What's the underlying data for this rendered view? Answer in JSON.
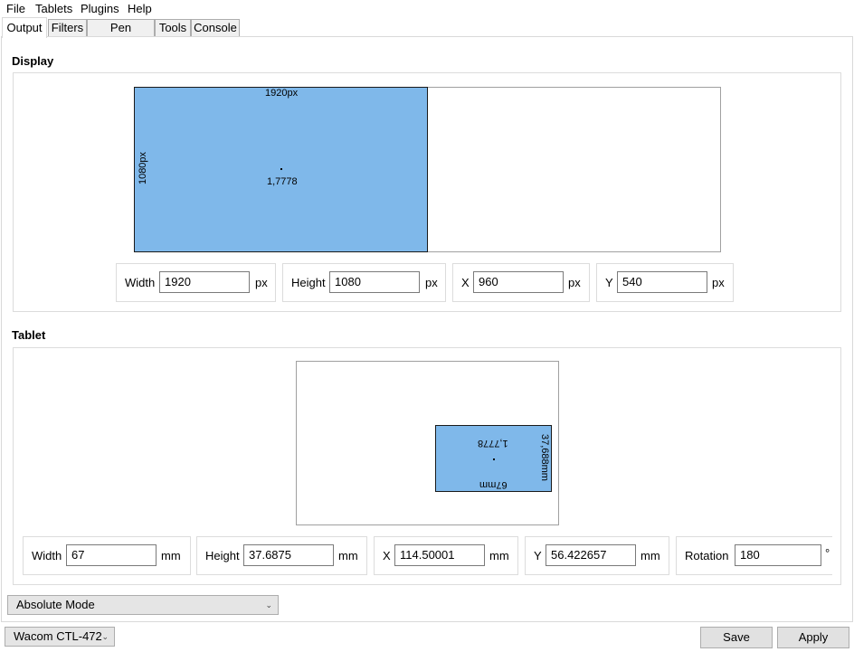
{
  "menu": {
    "file": "File",
    "tablets": "Tablets",
    "plugins": "Plugins",
    "help": "Help"
  },
  "tabs": {
    "output": "Output",
    "filters": "Filters",
    "pen_settings": "Pen Settings",
    "tools": "Tools",
    "console": "Console"
  },
  "display": {
    "title": "Display",
    "area": {
      "width_label": "1920px",
      "height_label": "1080px",
      "ratio": "1,7778"
    },
    "width": {
      "label": "Width",
      "value": "1920",
      "unit": "px"
    },
    "height": {
      "label": "Height",
      "value": "1080",
      "unit": "px"
    },
    "x": {
      "label": "X",
      "value": "960",
      "unit": "px"
    },
    "y": {
      "label": "Y",
      "value": "540",
      "unit": "px"
    }
  },
  "tablet": {
    "title": "Tablet",
    "area": {
      "width_label": "67mm",
      "height_label": "37,688mm",
      "ratio": "1,7778"
    },
    "width": {
      "label": "Width",
      "value": "67",
      "unit": "mm"
    },
    "height": {
      "label": "Height",
      "value": "37.6875",
      "unit": "mm"
    },
    "x": {
      "label": "X",
      "value": "114.50001",
      "unit": "mm"
    },
    "y": {
      "label": "Y",
      "value": "56.422657",
      "unit": "mm"
    },
    "rotation": {
      "label": "Rotation",
      "value": "180",
      "unit": "°"
    }
  },
  "mode_select": {
    "value": "Absolute Mode"
  },
  "tablet_select": {
    "value": "Wacom CTL-472"
  },
  "buttons": {
    "save": "Save",
    "apply": "Apply"
  },
  "icons": {
    "dropdown": "chevron-down-icon"
  },
  "colors": {
    "area_fill": "#7fb8ea",
    "panel_border": "#d9d9d9"
  }
}
